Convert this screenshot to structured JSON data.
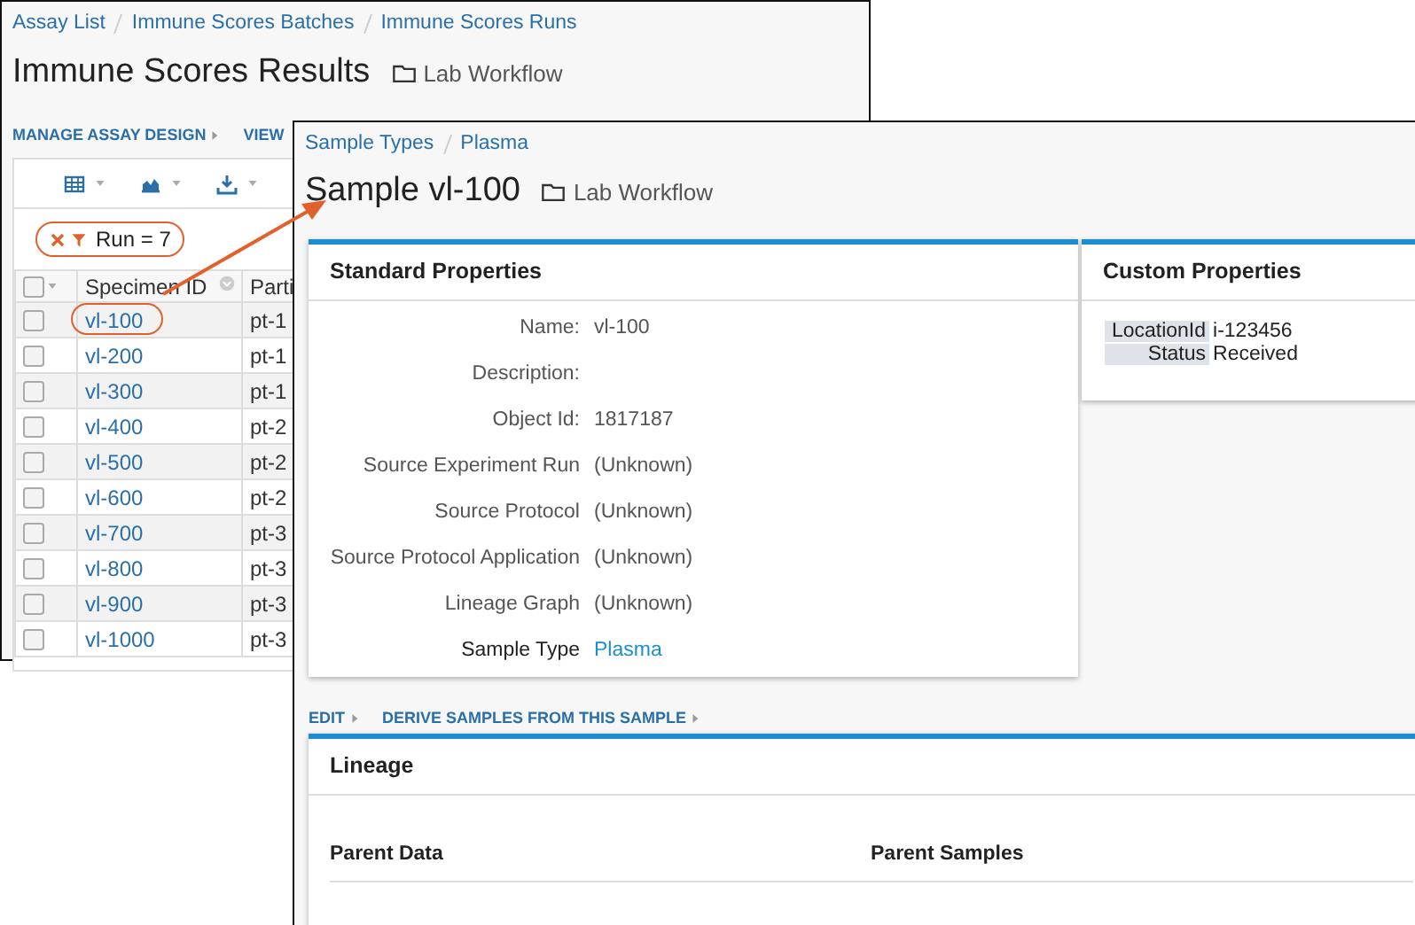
{
  "back_window": {
    "breadcrumbs": [
      "Assay List",
      "Immune Scores Batches",
      "Immune Scores Runs"
    ],
    "title": "Immune Scores Results",
    "folder": "Lab Workflow",
    "menu": [
      "MANAGE ASSAY DESIGN",
      "VIEW"
    ],
    "filter": {
      "label": "Run = 7"
    },
    "table": {
      "header_checked": false,
      "columns": [
        "Specimen ID",
        "Parti"
      ],
      "rows": [
        {
          "checked": false,
          "circled": true,
          "cells": [
            "vl-100",
            "pt-1"
          ]
        },
        {
          "checked": false,
          "circled": false,
          "cells": [
            "vl-200",
            "pt-1"
          ]
        },
        {
          "checked": false,
          "circled": false,
          "cells": [
            "vl-300",
            "pt-1"
          ]
        },
        {
          "checked": false,
          "circled": false,
          "cells": [
            "vl-400",
            "pt-2"
          ]
        },
        {
          "checked": false,
          "circled": false,
          "cells": [
            "vl-500",
            "pt-2"
          ]
        },
        {
          "checked": false,
          "circled": false,
          "cells": [
            "vl-600",
            "pt-2"
          ]
        },
        {
          "checked": false,
          "circled": false,
          "cells": [
            "vl-700",
            "pt-3"
          ]
        },
        {
          "checked": false,
          "circled": false,
          "cells": [
            "vl-800",
            "pt-3"
          ]
        },
        {
          "checked": false,
          "circled": false,
          "cells": [
            "vl-900",
            "pt-3"
          ]
        },
        {
          "checked": false,
          "circled": false,
          "cells": [
            "vl-1000",
            "pt-3"
          ]
        }
      ]
    }
  },
  "front_window": {
    "breadcrumbs": [
      "Sample Types",
      "Plasma"
    ],
    "title": "Sample vl-100",
    "folder": "Lab Workflow",
    "standard_properties": {
      "title": "Standard Properties",
      "rows": [
        {
          "label": "Name:",
          "value": "vl-100",
          "kind": "text"
        },
        {
          "label": "Description:",
          "kind": "text"
        },
        {
          "label": "Object Id:",
          "value": "1817187",
          "kind": "text"
        },
        {
          "label": "Source Experiment Run",
          "value": "(Unknown)",
          "kind": "text"
        },
        {
          "label": "Source Protocol",
          "value": "(Unknown)",
          "kind": "text"
        },
        {
          "label": "Source Protocol Application",
          "value": "(Unknown)",
          "kind": "text"
        },
        {
          "label": "Lineage Graph",
          "value": "(Unknown)",
          "kind": "text"
        },
        {
          "label": "Sample Type",
          "value": "Plasma",
          "kind": "link"
        }
      ]
    },
    "custom_properties": {
      "title": "Custom Properties",
      "rows": [
        {
          "label": "LocationId",
          "value": "i-123456"
        },
        {
          "label": "Status",
          "value": "Received"
        }
      ]
    },
    "actions": [
      "EDIT",
      "DERIVE SAMPLES FROM THIS SAMPLE"
    ],
    "lineage": {
      "title": "Lineage",
      "columns": [
        "Parent Data",
        "Parent Samples"
      ]
    }
  }
}
